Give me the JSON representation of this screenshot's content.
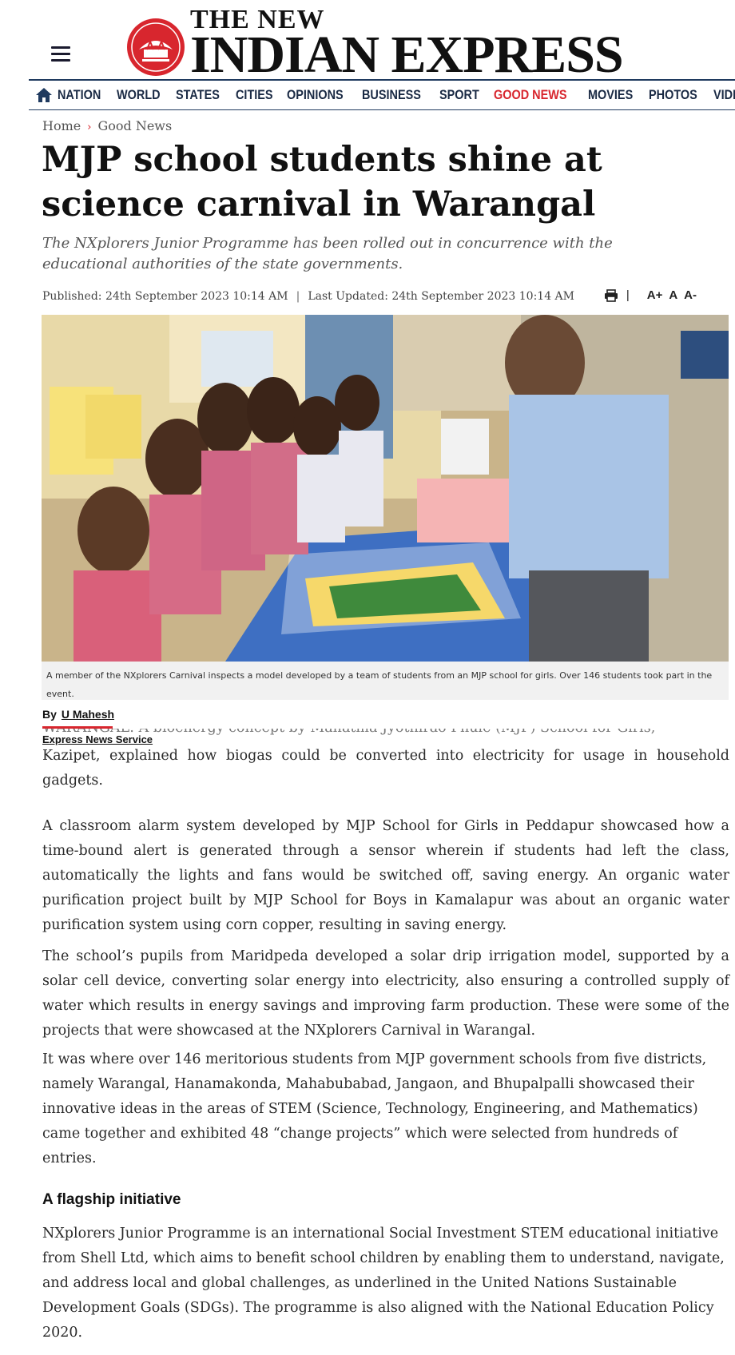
{
  "header": {
    "menu_icon": "hamburger-menu-icon",
    "logo_top": "THE NEW",
    "logo_main": "INDIAN EXPRESS",
    "brand_red": "#d8262e",
    "brand_navy": "#1f3a5f"
  },
  "nav": {
    "home_icon": "home-icon",
    "items": [
      {
        "label": "NATION"
      },
      {
        "label": "WORLD"
      },
      {
        "label": "STATES"
      },
      {
        "label": "CITIES"
      },
      {
        "label": "OPINIONS"
      },
      {
        "label": "BUSINESS"
      },
      {
        "label": "SPORT"
      },
      {
        "label": "GOOD NEWS",
        "active": true
      },
      {
        "label": "MOVIES"
      },
      {
        "label": "PHOTOS"
      },
      {
        "label": "VIDEOS"
      }
    ]
  },
  "breadcrumb": {
    "home": "Home",
    "section": "Good News"
  },
  "article": {
    "headline": "MJP school students shine at science carnival in Warangal",
    "subhead": "The NXplorers Junior Programme has been rolled out in concurrence with the educational authorities of the state governments.",
    "published": "Published: 24th September 2023 10:14 AM",
    "updated": "Last Updated: 24th September 2023 10:14 AM",
    "tools": {
      "print_icon": "print-icon",
      "font_increase": "A+",
      "font_normal": "A",
      "font_decrease": "A-"
    },
    "photo_caption": "A member of the NXplorers Carnival inspects a model developed by a team of students from an MJP school for girls. Over 146 students took part in the event.",
    "byline_prefix": "By",
    "author": "U Mahesh",
    "agency": "Express News Service",
    "overlap_line": "WARANGAL: A bioenergy concept by Mahatma Jyothirao Phule (MJP) School for Girls,",
    "paragraphs": [
      "Kazipet, explained how biogas could be converted into electricity for usage in household gadgets.",
      "A classroom alarm system developed by MJP School for Girls in Peddapur showcased how a time-bound alert is generated through a sensor wherein if students had left the class, automatically the lights and fans would be switched off, saving energy. An organic water purification project built by MJP  School for Boys in Kamalapur was about an organic water purification system using corn copper, resulting in saving energy.",
      "The school’s pupils from Maridpeda developed a solar drip irrigation model, supported by a solar cell device, converting solar energy into electricity, also ensuring a controlled supply of water which results in energy savings and improving farm production. These were some of the projects that were showcased at the NXplorers Carnival in Warangal.",
      "It was where over 146 meritorious students from MJP government schools from five districts, namely Warangal, Hanamakonda, Mahabubabad, Jangaon, and Bhupalpalli showcased their innovative ideas in the areas of STEM (Science, Technology, Engineering, and Mathematics) came together and exhibited 48 “change projects” which were selected from hundreds of entries."
    ],
    "subheading": "A flagship initiative",
    "final_paragraph": "NXplorers Junior Programme is an international Social Investment STEM educational initiative from Shell Ltd, which aims to benefit school children by enabling them to understand, navigate, and address local and global challenges, as underlined in the United Nations Sustainable Development Goals (SDGs). The programme is also aligned with the National Education Policy 2020."
  }
}
